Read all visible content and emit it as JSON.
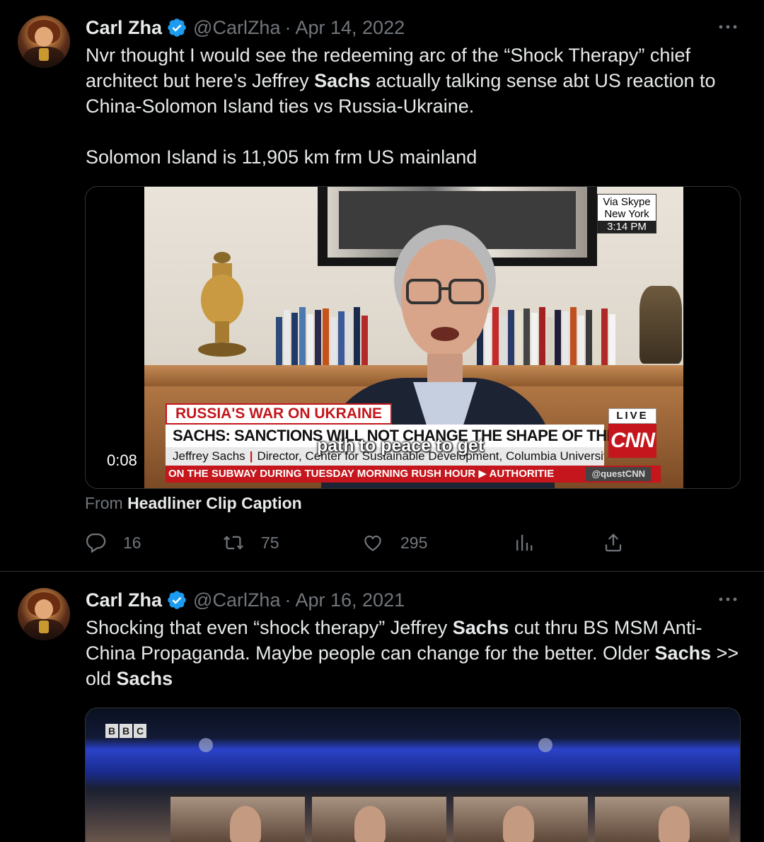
{
  "tweets": [
    {
      "name": "Carl Zha",
      "handle": "@CarlZha",
      "separator": "·",
      "date": "Apr 14, 2022",
      "text_p1_a": "Nvr thought I would see the redeeming arc of the “Shock Therapy” chief architect but here’s Jeffrey ",
      "text_p1_bold": "Sachs",
      "text_p1_b": " actually talking sense abt US reaction to China-Solomon Island ties vs Russia-Ukraine.",
      "text_p2": "Solomon Island is 11,905 km frm US mainland",
      "video": {
        "duration": "0:08",
        "skype_line1": "Via Skype",
        "skype_line2": "New York",
        "skype_time": "3:14 PM",
        "chyron_top": "RUSSIA'S WAR ON UKRAINE",
        "chyron_headline": "SACHS: SANCTIONS WILL NOT CHANGE THE SHAPE OF THE WAR",
        "chyron_name": "Jeffrey Sachs",
        "chyron_title": "Director, Center for Sustainable Development, Columbia University",
        "ticker": "ON THE SUBWAY DURING TUESDAY MORNING RUSH HOUR  ▶  AUTHORITIE",
        "ticker_handle": "@questCNN",
        "live": "LIVE",
        "network": "CNN",
        "subtitle": "path to peace to get"
      },
      "from_prefix": "From ",
      "from_source": "Headliner Clip Caption",
      "replies": "16",
      "retweets": "75",
      "likes": "295"
    },
    {
      "name": "Carl Zha",
      "handle": "@CarlZha",
      "separator": "·",
      "date": "Apr 16, 2021",
      "seg1": "Shocking that even “shock therapy” Jeffrey ",
      "seg2": "Sachs",
      "seg3": " cut thru BS MSM Anti-China Propaganda. Maybe people can change for the better. Older ",
      "seg4": "Sachs",
      "seg5": " >> old ",
      "seg6": "Sachs",
      "media_logo": [
        "B",
        "B",
        "C"
      ]
    }
  ],
  "colors": {
    "background": "#000000",
    "text_primary": "#e7e9ea",
    "text_secondary": "#71767b",
    "verified_blue": "#1d9bf0",
    "divider": "#2f3336",
    "cnn_red": "#c4161c"
  },
  "icons": [
    "verified-badge-icon",
    "more-icon",
    "reply-icon",
    "retweet-icon",
    "like-icon",
    "views-icon",
    "share-icon"
  ]
}
